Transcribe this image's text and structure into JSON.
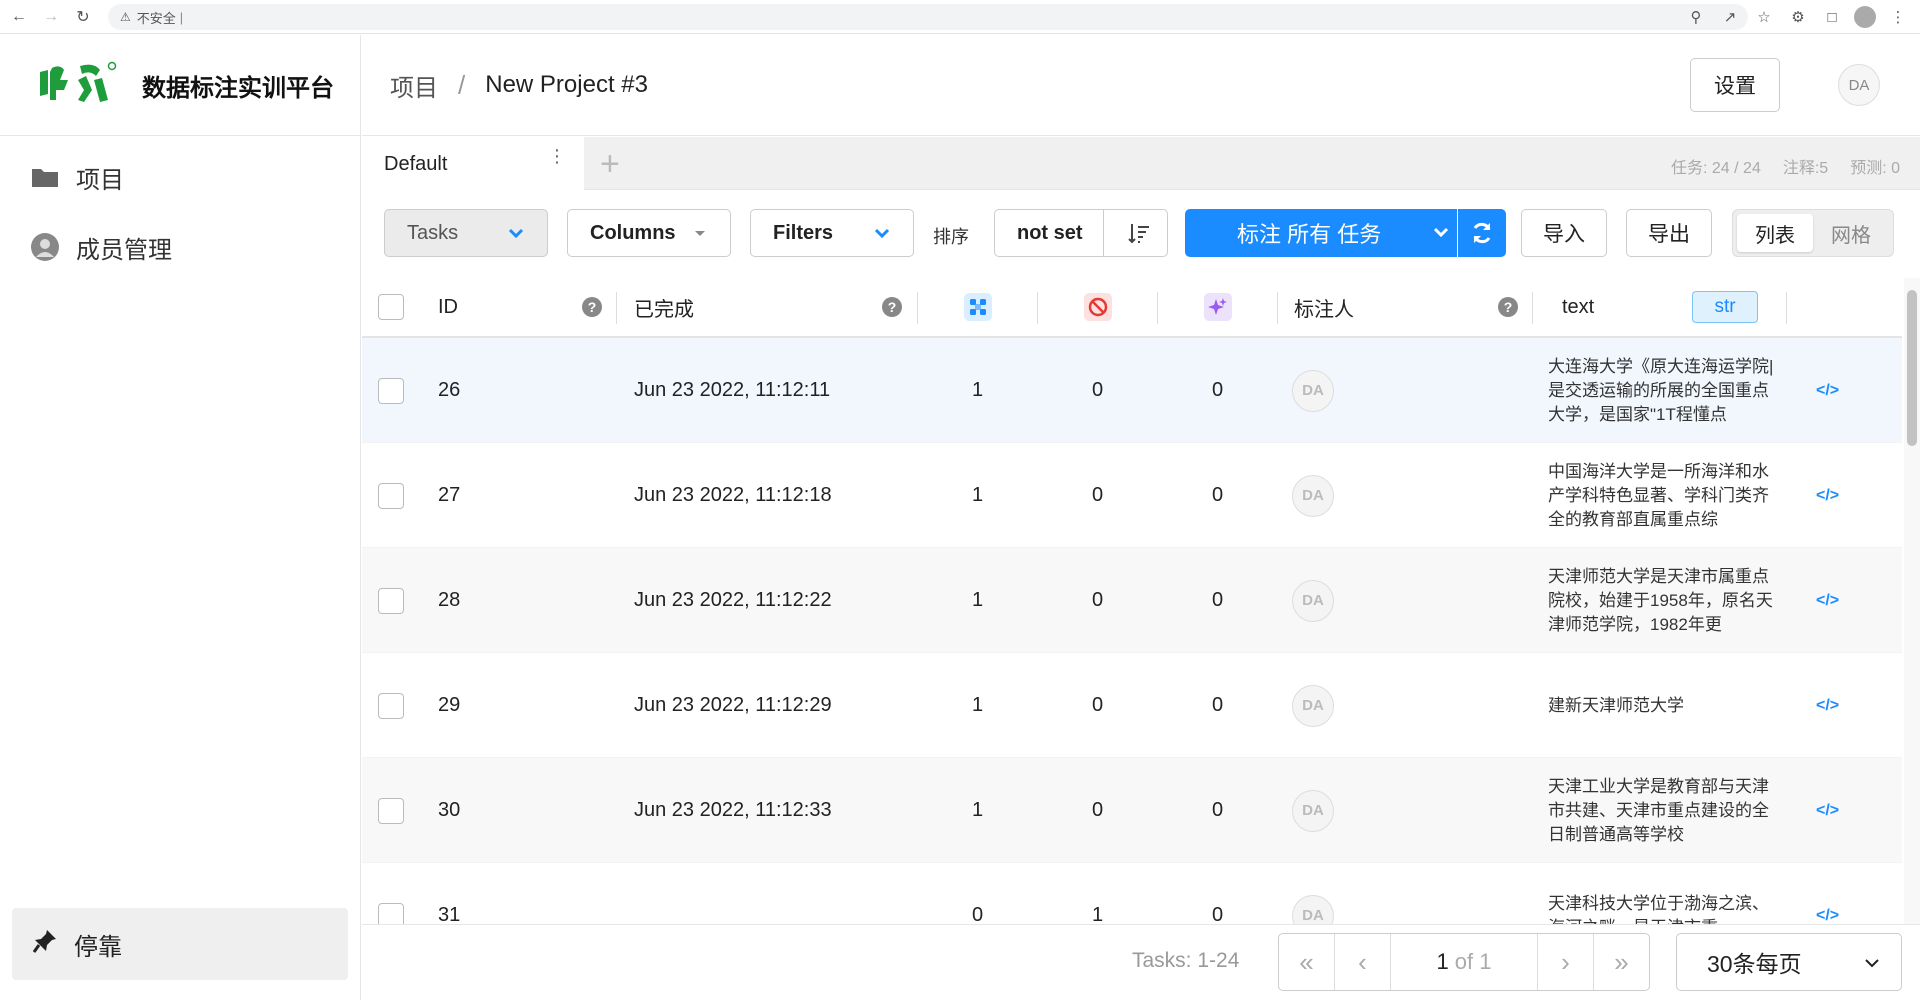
{
  "browser": {
    "security_label": "不安全"
  },
  "app": {
    "brand_title": "数据标注实训平台",
    "logo_text": "唯众"
  },
  "sidebar": {
    "items": [
      {
        "label": "项目",
        "icon": "folder-icon"
      },
      {
        "label": "成员管理",
        "icon": "user-icon"
      }
    ],
    "dock_label": "停靠"
  },
  "header": {
    "breadcrumb_root": "项目",
    "breadcrumb_sep": "/",
    "breadcrumb_current": "New Project #3",
    "settings_label": "设置",
    "avatar_initials": "DA"
  },
  "tabs": {
    "default_label": "Default",
    "stats": {
      "tasks": "任务: 24 / 24",
      "annotations": "注释:5",
      "predictions": "预测: 0"
    }
  },
  "toolbar": {
    "tasks_label": "Tasks",
    "columns_label": "Columns",
    "filters_label": "Filters",
    "sort_label": "排序",
    "sort_value": "not set",
    "label_all": "标注 所有 任务",
    "import_label": "导入",
    "export_label": "导出",
    "view_list": "列表",
    "view_grid": "网格"
  },
  "table": {
    "headers": {
      "id": "ID",
      "completed": "已完成",
      "annotator": "标注人",
      "text": "text",
      "text_type": "str"
    },
    "rows": [
      {
        "id": "26",
        "completed": "Jun 23 2022, 11:12:11",
        "total": "1",
        "cancelled": "0",
        "predictions": "0",
        "annotator": "DA",
        "text": "大连海大学《原大连海运学院|是交透运输的所展的全国重点大学，是国家\"1T程懂点"
      },
      {
        "id": "27",
        "completed": "Jun 23 2022, 11:12:18",
        "total": "1",
        "cancelled": "0",
        "predictions": "0",
        "annotator": "DA",
        "text": "中国海洋大学是一所海洋和水产学科特色显著、学科门类齐全的教育部直属重点综"
      },
      {
        "id": "28",
        "completed": "Jun 23 2022, 11:12:22",
        "total": "1",
        "cancelled": "0",
        "predictions": "0",
        "annotator": "DA",
        "text": "天津师范大学是天津市属重点院校，始建于1958年，原名天津师范学院，1982年更"
      },
      {
        "id": "29",
        "completed": "Jun 23 2022, 11:12:29",
        "total": "1",
        "cancelled": "0",
        "predictions": "0",
        "annotator": "DA",
        "text": "建新天津师范大学"
      },
      {
        "id": "30",
        "completed": "Jun 23 2022, 11:12:33",
        "total": "1",
        "cancelled": "0",
        "predictions": "0",
        "annotator": "DA",
        "text": "天津工业大学是教育部与天津市共建、天津市重点建设的全日制普通高等学校"
      },
      {
        "id": "31",
        "completed": "",
        "total": "0",
        "cancelled": "1",
        "predictions": "0",
        "annotator": "DA",
        "text": "天津科技大学位于渤海之滨、海河之畔，是天津市重"
      }
    ]
  },
  "footer": {
    "tasks_range": "Tasks: 1-24",
    "page_current": "1",
    "page_of": "of 1",
    "per_page": "30条每页"
  },
  "colors": {
    "accent": "#1a8cff",
    "brand_green": "#1f9d3c"
  }
}
